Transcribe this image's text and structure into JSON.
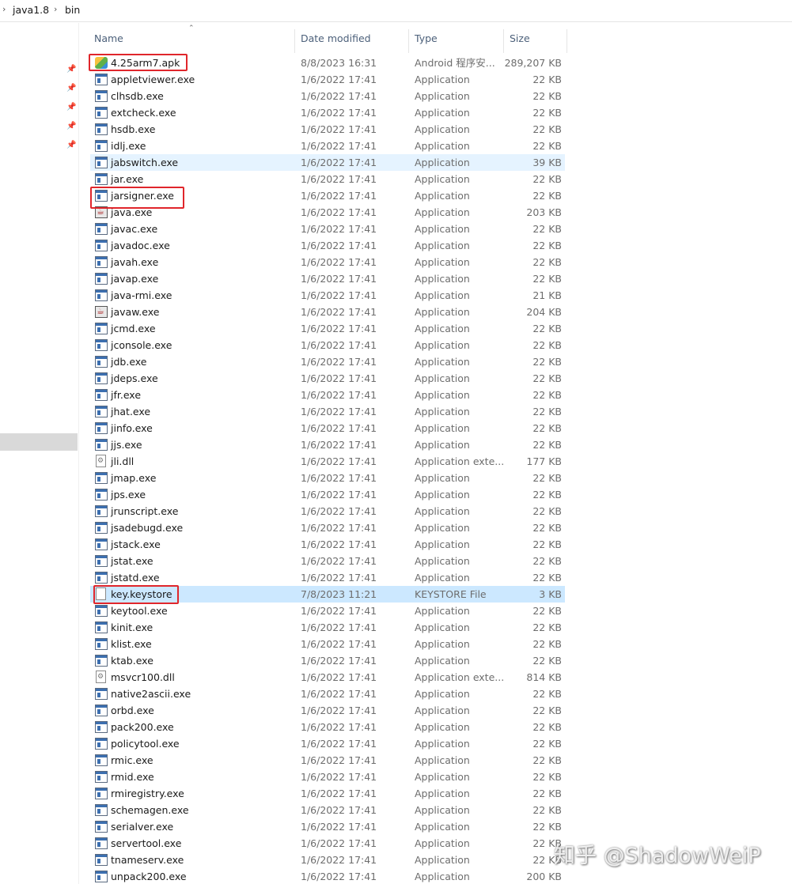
{
  "breadcrumb": {
    "segments": [
      "java1.8",
      "bin"
    ]
  },
  "columns": {
    "name": "Name",
    "date": "Date modified",
    "type": "Type",
    "size": "Size"
  },
  "files": [
    {
      "name": "4.25arm7.apk",
      "date": "8/8/2023 16:31",
      "type": "Android 程序安...",
      "size": "289,207 KB",
      "icon": "apk-icon"
    },
    {
      "name": "appletviewer.exe",
      "date": "1/6/2022 17:41",
      "type": "Application",
      "size": "22 KB",
      "icon": "exe-icon"
    },
    {
      "name": "clhsdb.exe",
      "date": "1/6/2022 17:41",
      "type": "Application",
      "size": "22 KB",
      "icon": "exe-icon"
    },
    {
      "name": "extcheck.exe",
      "date": "1/6/2022 17:41",
      "type": "Application",
      "size": "22 KB",
      "icon": "exe-icon"
    },
    {
      "name": "hsdb.exe",
      "date": "1/6/2022 17:41",
      "type": "Application",
      "size": "22 KB",
      "icon": "exe-icon"
    },
    {
      "name": "idlj.exe",
      "date": "1/6/2022 17:41",
      "type": "Application",
      "size": "22 KB",
      "icon": "exe-icon"
    },
    {
      "name": "jabswitch.exe",
      "date": "1/6/2022 17:41",
      "type": "Application",
      "size": "39 KB",
      "icon": "exe-icon",
      "state": "hover"
    },
    {
      "name": "jar.exe",
      "date": "1/6/2022 17:41",
      "type": "Application",
      "size": "22 KB",
      "icon": "exe-icon"
    },
    {
      "name": "jarsigner.exe",
      "date": "1/6/2022 17:41",
      "type": "Application",
      "size": "22 KB",
      "icon": "exe-icon"
    },
    {
      "name": "java.exe",
      "date": "1/6/2022 17:41",
      "type": "Application",
      "size": "203 KB",
      "icon": "java-icon"
    },
    {
      "name": "javac.exe",
      "date": "1/6/2022 17:41",
      "type": "Application",
      "size": "22 KB",
      "icon": "exe-icon"
    },
    {
      "name": "javadoc.exe",
      "date": "1/6/2022 17:41",
      "type": "Application",
      "size": "22 KB",
      "icon": "exe-icon"
    },
    {
      "name": "javah.exe",
      "date": "1/6/2022 17:41",
      "type": "Application",
      "size": "22 KB",
      "icon": "exe-icon"
    },
    {
      "name": "javap.exe",
      "date": "1/6/2022 17:41",
      "type": "Application",
      "size": "22 KB",
      "icon": "exe-icon"
    },
    {
      "name": "java-rmi.exe",
      "date": "1/6/2022 17:41",
      "type": "Application",
      "size": "21 KB",
      "icon": "exe-icon"
    },
    {
      "name": "javaw.exe",
      "date": "1/6/2022 17:41",
      "type": "Application",
      "size": "204 KB",
      "icon": "java-icon"
    },
    {
      "name": "jcmd.exe",
      "date": "1/6/2022 17:41",
      "type": "Application",
      "size": "22 KB",
      "icon": "exe-icon"
    },
    {
      "name": "jconsole.exe",
      "date": "1/6/2022 17:41",
      "type": "Application",
      "size": "22 KB",
      "icon": "exe-icon"
    },
    {
      "name": "jdb.exe",
      "date": "1/6/2022 17:41",
      "type": "Application",
      "size": "22 KB",
      "icon": "exe-icon"
    },
    {
      "name": "jdeps.exe",
      "date": "1/6/2022 17:41",
      "type": "Application",
      "size": "22 KB",
      "icon": "exe-icon"
    },
    {
      "name": "jfr.exe",
      "date": "1/6/2022 17:41",
      "type": "Application",
      "size": "22 KB",
      "icon": "exe-icon"
    },
    {
      "name": "jhat.exe",
      "date": "1/6/2022 17:41",
      "type": "Application",
      "size": "22 KB",
      "icon": "exe-icon"
    },
    {
      "name": "jinfo.exe",
      "date": "1/6/2022 17:41",
      "type": "Application",
      "size": "22 KB",
      "icon": "exe-icon"
    },
    {
      "name": "jjs.exe",
      "date": "1/6/2022 17:41",
      "type": "Application",
      "size": "22 KB",
      "icon": "exe-icon"
    },
    {
      "name": "jli.dll",
      "date": "1/6/2022 17:41",
      "type": "Application exte...",
      "size": "177 KB",
      "icon": "dll-icon"
    },
    {
      "name": "jmap.exe",
      "date": "1/6/2022 17:41",
      "type": "Application",
      "size": "22 KB",
      "icon": "exe-icon"
    },
    {
      "name": "jps.exe",
      "date": "1/6/2022 17:41",
      "type": "Application",
      "size": "22 KB",
      "icon": "exe-icon"
    },
    {
      "name": "jrunscript.exe",
      "date": "1/6/2022 17:41",
      "type": "Application",
      "size": "22 KB",
      "icon": "exe-icon"
    },
    {
      "name": "jsadebugd.exe",
      "date": "1/6/2022 17:41",
      "type": "Application",
      "size": "22 KB",
      "icon": "exe-icon"
    },
    {
      "name": "jstack.exe",
      "date": "1/6/2022 17:41",
      "type": "Application",
      "size": "22 KB",
      "icon": "exe-icon"
    },
    {
      "name": "jstat.exe",
      "date": "1/6/2022 17:41",
      "type": "Application",
      "size": "22 KB",
      "icon": "exe-icon"
    },
    {
      "name": "jstatd.exe",
      "date": "1/6/2022 17:41",
      "type": "Application",
      "size": "22 KB",
      "icon": "exe-icon"
    },
    {
      "name": "key.keystore",
      "date": "7/8/2023 11:21",
      "type": "KEYSTORE File",
      "size": "3 KB",
      "icon": "file-icon",
      "state": "selected"
    },
    {
      "name": "keytool.exe",
      "date": "1/6/2022 17:41",
      "type": "Application",
      "size": "22 KB",
      "icon": "exe-icon"
    },
    {
      "name": "kinit.exe",
      "date": "1/6/2022 17:41",
      "type": "Application",
      "size": "22 KB",
      "icon": "exe-icon"
    },
    {
      "name": "klist.exe",
      "date": "1/6/2022 17:41",
      "type": "Application",
      "size": "22 KB",
      "icon": "exe-icon"
    },
    {
      "name": "ktab.exe",
      "date": "1/6/2022 17:41",
      "type": "Application",
      "size": "22 KB",
      "icon": "exe-icon"
    },
    {
      "name": "msvcr100.dll",
      "date": "1/6/2022 17:41",
      "type": "Application exte...",
      "size": "814 KB",
      "icon": "dll-icon"
    },
    {
      "name": "native2ascii.exe",
      "date": "1/6/2022 17:41",
      "type": "Application",
      "size": "22 KB",
      "icon": "exe-icon"
    },
    {
      "name": "orbd.exe",
      "date": "1/6/2022 17:41",
      "type": "Application",
      "size": "22 KB",
      "icon": "exe-icon"
    },
    {
      "name": "pack200.exe",
      "date": "1/6/2022 17:41",
      "type": "Application",
      "size": "22 KB",
      "icon": "exe-icon"
    },
    {
      "name": "policytool.exe",
      "date": "1/6/2022 17:41",
      "type": "Application",
      "size": "22 KB",
      "icon": "exe-icon"
    },
    {
      "name": "rmic.exe",
      "date": "1/6/2022 17:41",
      "type": "Application",
      "size": "22 KB",
      "icon": "exe-icon"
    },
    {
      "name": "rmid.exe",
      "date": "1/6/2022 17:41",
      "type": "Application",
      "size": "22 KB",
      "icon": "exe-icon"
    },
    {
      "name": "rmiregistry.exe",
      "date": "1/6/2022 17:41",
      "type": "Application",
      "size": "22 KB",
      "icon": "exe-icon"
    },
    {
      "name": "schemagen.exe",
      "date": "1/6/2022 17:41",
      "type": "Application",
      "size": "22 KB",
      "icon": "exe-icon"
    },
    {
      "name": "serialver.exe",
      "date": "1/6/2022 17:41",
      "type": "Application",
      "size": "22 KB",
      "icon": "exe-icon"
    },
    {
      "name": "servertool.exe",
      "date": "1/6/2022 17:41",
      "type": "Application",
      "size": "22 KB",
      "icon": "exe-icon"
    },
    {
      "name": "tnameserv.exe",
      "date": "1/6/2022 17:41",
      "type": "Application",
      "size": "22 KB",
      "icon": "exe-icon"
    },
    {
      "name": "unpack200.exe",
      "date": "1/6/2022 17:41",
      "type": "Application",
      "size": "200 KB",
      "icon": "exe-icon"
    }
  ],
  "highlighted_files": [
    "4.25arm7.apk",
    "jarsigner.exe",
    "key.keystore"
  ],
  "highlight_color": "#e0262b",
  "selection_color": "#cce8ff",
  "hover_color": "#e5f3ff",
  "nav_pane": {
    "pin_icon": "pin-icon"
  },
  "watermark": "知乎 @ShadowWeiP"
}
